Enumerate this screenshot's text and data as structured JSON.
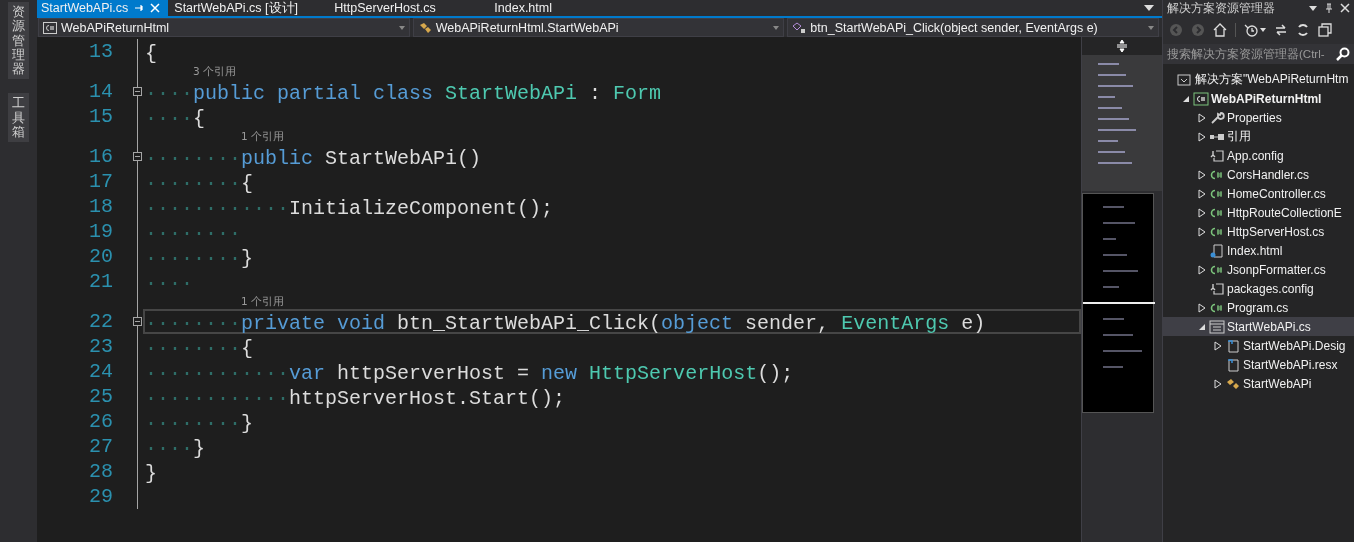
{
  "side_strip": {
    "tabs": [
      {
        "label": "资源管理器",
        "selected": false
      },
      {
        "label": "工具箱",
        "selected": false
      }
    ]
  },
  "tabs": [
    {
      "label": "StartWebAPi.cs",
      "selected": true
    },
    {
      "label": "StartWebAPi.cs [设计]",
      "selected": false
    },
    {
      "label": "HttpServerHost.cs",
      "selected": false
    },
    {
      "label": "Index.html",
      "selected": false
    }
  ],
  "nav": {
    "project": "WebAPiReturnHtml",
    "type": "WebAPiReturnHtml.StartWebAPi",
    "member": "btn_StartWebAPi_Click(object sender, EventArgs e)"
  },
  "editor": {
    "lines": [
      {
        "num": "13",
        "foldable": false,
        "current": false,
        "tokens": [
          {
            "kind": "plain",
            "text": "{"
          }
        ]
      },
      {
        "num": "14",
        "lens": "3 个引用",
        "foldable": true,
        "current": false,
        "indent": "····",
        "tokens": [
          {
            "kind": "keyword",
            "text": "public partial class "
          },
          {
            "kind": "type",
            "text": "StartWebAPi"
          },
          {
            "kind": "plain",
            "text": " : "
          },
          {
            "kind": "type",
            "text": "Form"
          }
        ]
      },
      {
        "num": "15",
        "foldable": false,
        "current": false,
        "indent": "····",
        "tokens": [
          {
            "kind": "plain",
            "text": "{"
          }
        ]
      },
      {
        "num": "16",
        "lens": "1 个引用",
        "foldable": true,
        "current": false,
        "indent": "········",
        "tokens": [
          {
            "kind": "keyword",
            "text": "public"
          },
          {
            "kind": "plain",
            "text": " StartWebAPi()"
          }
        ]
      },
      {
        "num": "17",
        "foldable": false,
        "current": false,
        "indent": "········",
        "tokens": [
          {
            "kind": "plain",
            "text": "{"
          }
        ]
      },
      {
        "num": "18",
        "foldable": false,
        "current": false,
        "indent": "············",
        "tokens": [
          {
            "kind": "plain",
            "text": "InitializeComponent();"
          }
        ]
      },
      {
        "num": "19",
        "foldable": false,
        "current": false,
        "indent": "········"
      },
      {
        "num": "20",
        "foldable": false,
        "current": false,
        "indent": "········",
        "tokens": [
          {
            "kind": "plain",
            "text": "}"
          }
        ]
      },
      {
        "num": "21",
        "foldable": false,
        "current": false,
        "indent": "····"
      },
      {
        "num": "22",
        "lens": "1 个引用",
        "foldable": true,
        "current": true,
        "indent": "········",
        "tokens": [
          {
            "kind": "keyword",
            "text": "private void"
          },
          {
            "kind": "plain",
            "text": " btn_StartWebAPi_Click("
          },
          {
            "kind": "keyword",
            "text": "object"
          },
          {
            "kind": "plain",
            "text": " sender, "
          },
          {
            "kind": "type",
            "text": "EventArgs"
          },
          {
            "kind": "plain",
            "text": " e)"
          }
        ]
      },
      {
        "num": "23",
        "foldable": false,
        "current": false,
        "indent": "········",
        "tokens": [
          {
            "kind": "plain",
            "text": "{"
          }
        ]
      },
      {
        "num": "24",
        "foldable": false,
        "current": false,
        "indent": "············",
        "tokens": [
          {
            "kind": "keyword",
            "text": "var"
          },
          {
            "kind": "plain",
            "text": " httpServerHost = "
          },
          {
            "kind": "keyword",
            "text": "new "
          },
          {
            "kind": "type",
            "text": "HttpServerHost"
          },
          {
            "kind": "plain",
            "text": "();"
          }
        ]
      },
      {
        "num": "25",
        "foldable": false,
        "current": false,
        "indent": "············",
        "tokens": [
          {
            "kind": "plain",
            "text": "httpServerHost.Start();"
          }
        ]
      },
      {
        "num": "26",
        "foldable": false,
        "current": false,
        "indent": "········",
        "tokens": [
          {
            "kind": "plain",
            "text": "}"
          }
        ]
      },
      {
        "num": "27",
        "foldable": false,
        "current": false,
        "indent": "····",
        "tokens": [
          {
            "kind": "plain",
            "text": "}"
          }
        ]
      },
      {
        "num": "28",
        "foldable": false,
        "current": false,
        "tokens": [
          {
            "kind": "plain",
            "text": "}"
          }
        ]
      },
      {
        "num": "29",
        "foldable": false,
        "current": false
      }
    ]
  },
  "explorer": {
    "title": "解决方案资源管理器",
    "search": {
      "placeholder": "搜索解决方案资源管理器(Ctrl-"
    },
    "tree": [
      {
        "label": "解决方案\"WebAPiReturnHtm",
        "kind": "solution",
        "selected": false,
        "children": [
          {
            "label": "WebAPiReturnHtml",
            "kind": "project",
            "expanded": true,
            "selected": false,
            "children": [
              {
                "label": "Properties",
                "kind": "wrench",
                "expanded": false,
                "selected": false
              },
              {
                "label": "引用",
                "kind": "refs",
                "expanded": false,
                "selected": false
              },
              {
                "label": "App.config",
                "kind": "config",
                "selected": false
              },
              {
                "label": "CorsHandler.cs",
                "kind": "csharp",
                "expanded": false,
                "selected": false
              },
              {
                "label": "HomeController.cs",
                "kind": "csharp",
                "expanded": false,
                "selected": false
              },
              {
                "label": "HttpRouteCollectionE",
                "kind": "csharp",
                "expanded": false,
                "selected": false
              },
              {
                "label": "HttpServerHost.cs",
                "kind": "csharp",
                "expanded": false,
                "selected": false
              },
              {
                "label": "Index.html",
                "kind": "html",
                "selected": false
              },
              {
                "label": "JsonpFormatter.cs",
                "kind": "csharp",
                "expanded": false,
                "selected": false
              },
              {
                "label": "packages.config",
                "kind": "config",
                "selected": false
              },
              {
                "label": "Program.cs",
                "kind": "csharp",
                "expanded": false,
                "selected": false
              },
              {
                "label": "StartWebAPi.cs",
                "kind": "form",
                "expanded": true,
                "selected": true,
                "children": [
                  {
                    "label": "StartWebAPi.Desig",
                    "kind": "file",
                    "expanded": false,
                    "selected": false
                  },
                  {
                    "label": "StartWebAPi.resx",
                    "kind": "file",
                    "selected": false
                  },
                  {
                    "label": "StartWebAPi",
                    "kind": "class",
                    "expanded": false,
                    "selected": false
                  }
                ]
              }
            ]
          }
        ]
      }
    ]
  }
}
